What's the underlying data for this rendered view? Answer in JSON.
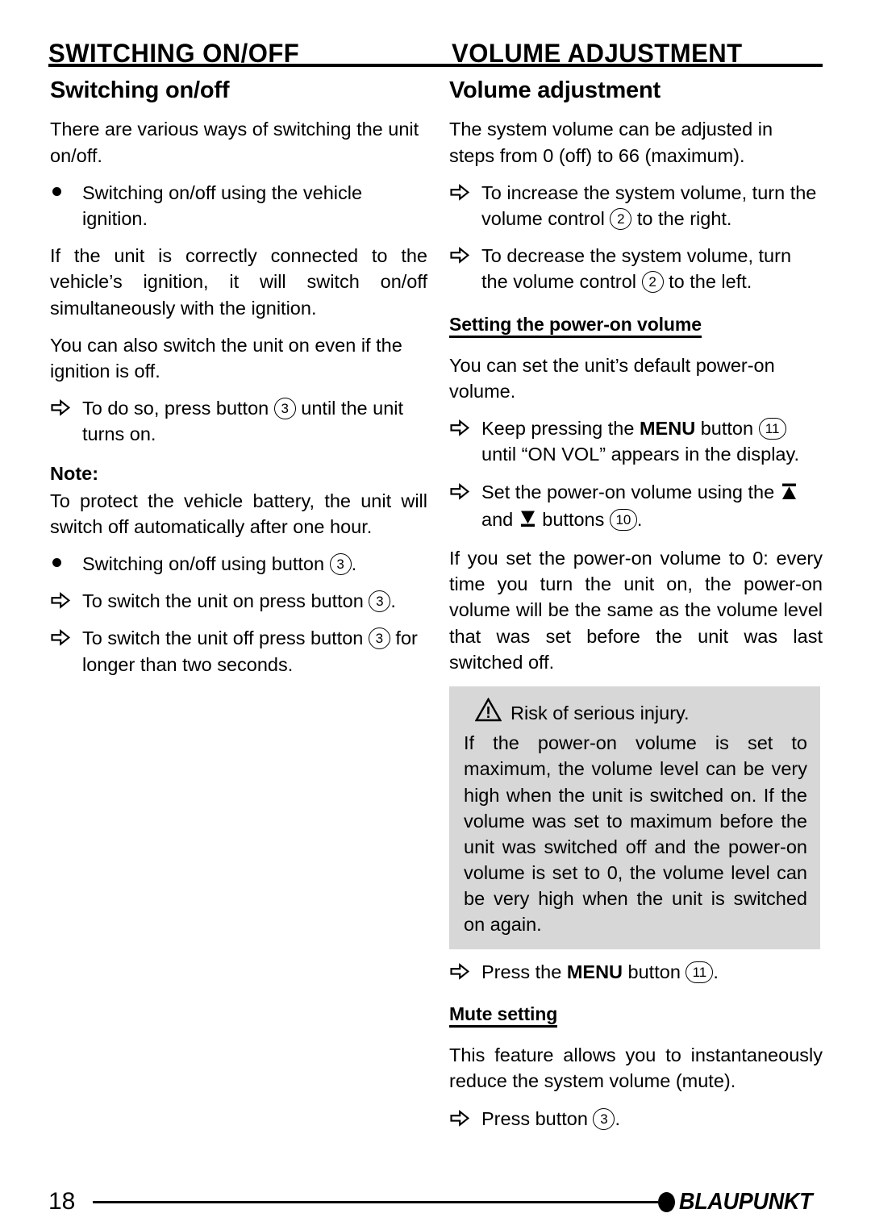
{
  "header": {
    "left_title": "SWITCHING ON/OFF",
    "right_title": "VOLUME ADJUSTMENT"
  },
  "left_column": {
    "section_title": "Switching on/off",
    "intro": "There are various ways of switching the unit on/off.",
    "bullet_ignition": "Switching on/off using the vehicle ignition.",
    "para_connected": "If the unit is correctly connected to the vehicle’s ignition, it will switch on/off simultaneously with the ignition.",
    "para_also": "You can also switch the unit on even if the ignition is off.",
    "step_do_so_pre": "To do so, press button",
    "step_do_so_num": "3",
    "step_do_so_post": "until the unit turns on.",
    "note_label": "Note:",
    "note_text": "To protect the vehicle battery, the unit will switch off automatically after one hour.",
    "bullet_button_pre": "Switching on/off using button",
    "bullet_button_num": "3",
    "bullet_button_post": ".",
    "step_on_pre": "To switch the unit on press button",
    "step_on_num": "3",
    "step_on_post": ".",
    "step_off_pre": "To switch the unit off press button",
    "step_off_num": "3",
    "step_off_post": "for longer than two seconds."
  },
  "right_column": {
    "section_title": "Volume adjustment",
    "intro": "The system volume can be adjusted in steps from 0 (off) to 66 (maximum).",
    "step_increase_pre": "To increase the system volume, turn the volume control",
    "step_increase_num": "2",
    "step_increase_post": "to the right.",
    "step_decrease_pre": "To decrease the system volume, turn the volume control",
    "step_decrease_num": "2",
    "step_decrease_post": "to the left.",
    "sub_power_on": "Setting the power-on volume",
    "para_default": "You can set the unit’s default power-on volume.",
    "step_menu_pre": "Keep pressing the",
    "step_menu_bold": "MENU",
    "step_menu_mid": "button",
    "step_menu_num": "11",
    "step_menu_post": "until “ON VOL” appears in the display.",
    "step_set_pre": "Set the power-on volume using the",
    "step_set_mid": "and",
    "step_set_post": "buttons",
    "step_set_num": "10",
    "step_set_end": ".",
    "para_zero": "If you set the power-on volume to 0: every time you turn the unit on, the power-on volume will be the same as the volume level that was set before the unit was last switched off.",
    "warning": {
      "heading": "Risk of serious injury.",
      "body": "If the power-on volume is set to maximum, the volume level can be very high when the unit is switched on. If the volume was set to maximum before the unit was switched off and the power-on volume is set to 0, the volume level can be very high when the unit is switched on again."
    },
    "step_press_menu_pre": "Press the",
    "step_press_menu_bold": "MENU",
    "step_press_menu_mid": "button",
    "step_press_menu_num": "11",
    "step_press_menu_post": ".",
    "sub_mute": "Mute setting",
    "para_mute": "This feature allows you to instantaneously reduce the system volume (mute).",
    "step_press_button_pre": "Press button",
    "step_press_button_num": "3",
    "step_press_button_post": "."
  },
  "footer": {
    "page_number": "18",
    "brand": "BLAUPUNKT"
  },
  "colors": {
    "warning_background": "#d7d7d7",
    "text": "#000000",
    "page_background": "#ffffff"
  }
}
